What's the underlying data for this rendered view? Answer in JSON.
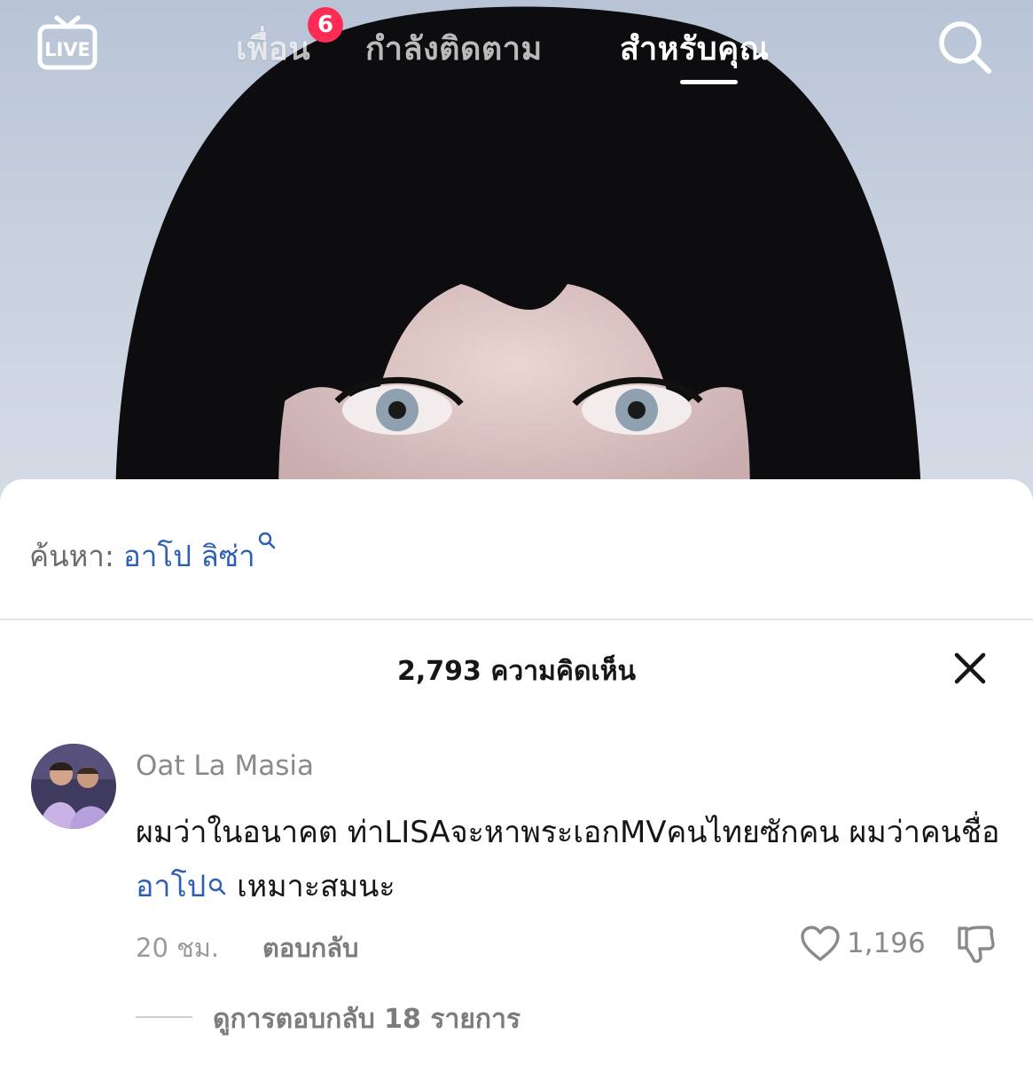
{
  "top_nav": {
    "live_label": "LIVE",
    "tabs": [
      {
        "label": "เพื่อน",
        "badge": "6"
      },
      {
        "label": "กำลังติดตาม"
      },
      {
        "label": "สำหรับคุณ",
        "active": true
      }
    ]
  },
  "search_banner": {
    "prefix": "ค้นหา:",
    "term": "อาโป ลิซ่า"
  },
  "comments": {
    "header": "2,793 ความคิดเห็น",
    "items": [
      {
        "author": "Oat La Masia",
        "text_before": "ผมว่าในอนาคต ท่าLISAจะหาพระเอกMVคนไทยซักคน ผมว่าคนชื่อ ",
        "mention": "อาโป",
        "text_after": " เหมาะสมนะ",
        "time": "20 ชม.",
        "reply_label": "ตอบกลับ",
        "likes": "1,196",
        "view_replies": "ดูการตอบกลับ 18 รายการ"
      }
    ]
  },
  "colors": {
    "accent_link": "#2f5fb3",
    "badge": "#fe2c55"
  }
}
